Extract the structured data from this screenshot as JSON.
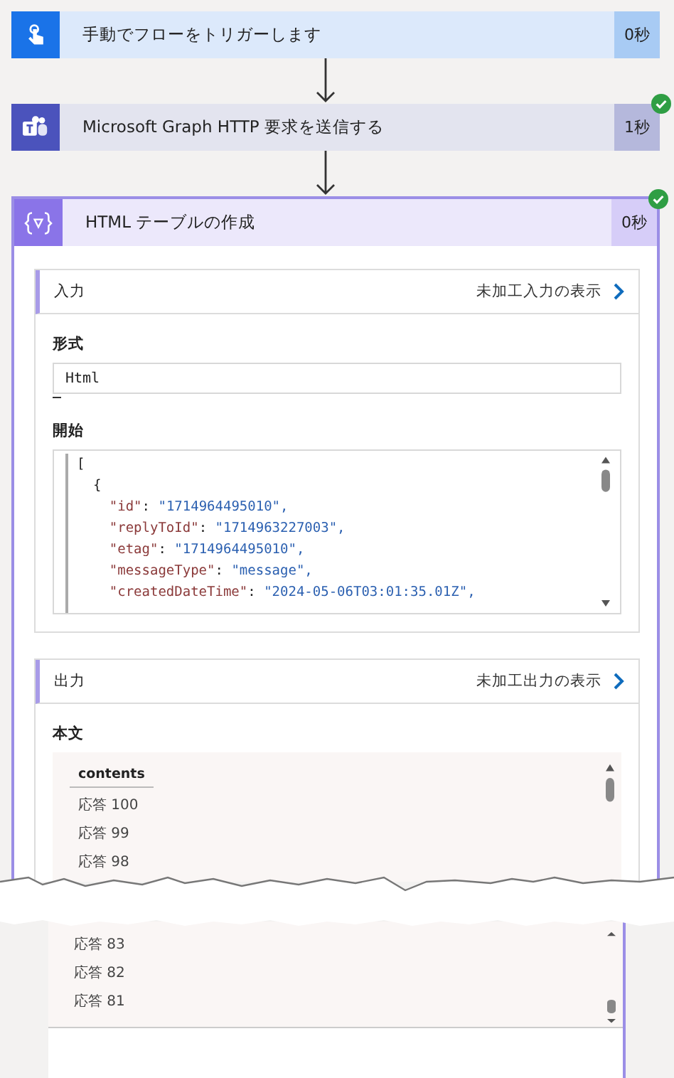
{
  "steps": [
    {
      "kind": "trigger",
      "title": "手動でフローをトリガーします",
      "duration": "0秒",
      "succeeded": false,
      "expanded": false
    },
    {
      "kind": "teams",
      "title": "Microsoft Graph HTTP 要求を送信する",
      "duration": "1秒",
      "succeeded": true,
      "expanded": false
    },
    {
      "kind": "compose",
      "title": "HTML テーブルの作成",
      "duration": "0秒",
      "succeeded": true,
      "expanded": true
    }
  ],
  "input": {
    "title": "入力",
    "link": "未加工入力の表示",
    "format": {
      "label": "形式",
      "value": "Html"
    },
    "from": {
      "label": "開始",
      "lines": [
        "[",
        "  {",
        "    \"id\": \"1714964495010\",",
        "    \"replyToId\": \"1714963227003\",",
        "    \"etag\": \"1714964495010\",",
        "    \"messageType\": \"message\",",
        "    \"createdDateTime\": \"2024-05-06T03:01:35.01Z\","
      ]
    }
  },
  "output": {
    "title": "出力",
    "link": "未加工出力の表示",
    "body": {
      "label": "本文",
      "column": "contents",
      "rows_top": [
        "応答 100",
        "応答 99",
        "応答 98"
      ],
      "rows_bottom": [
        "応答 83",
        "応答 82",
        "応答 81"
      ]
    }
  }
}
